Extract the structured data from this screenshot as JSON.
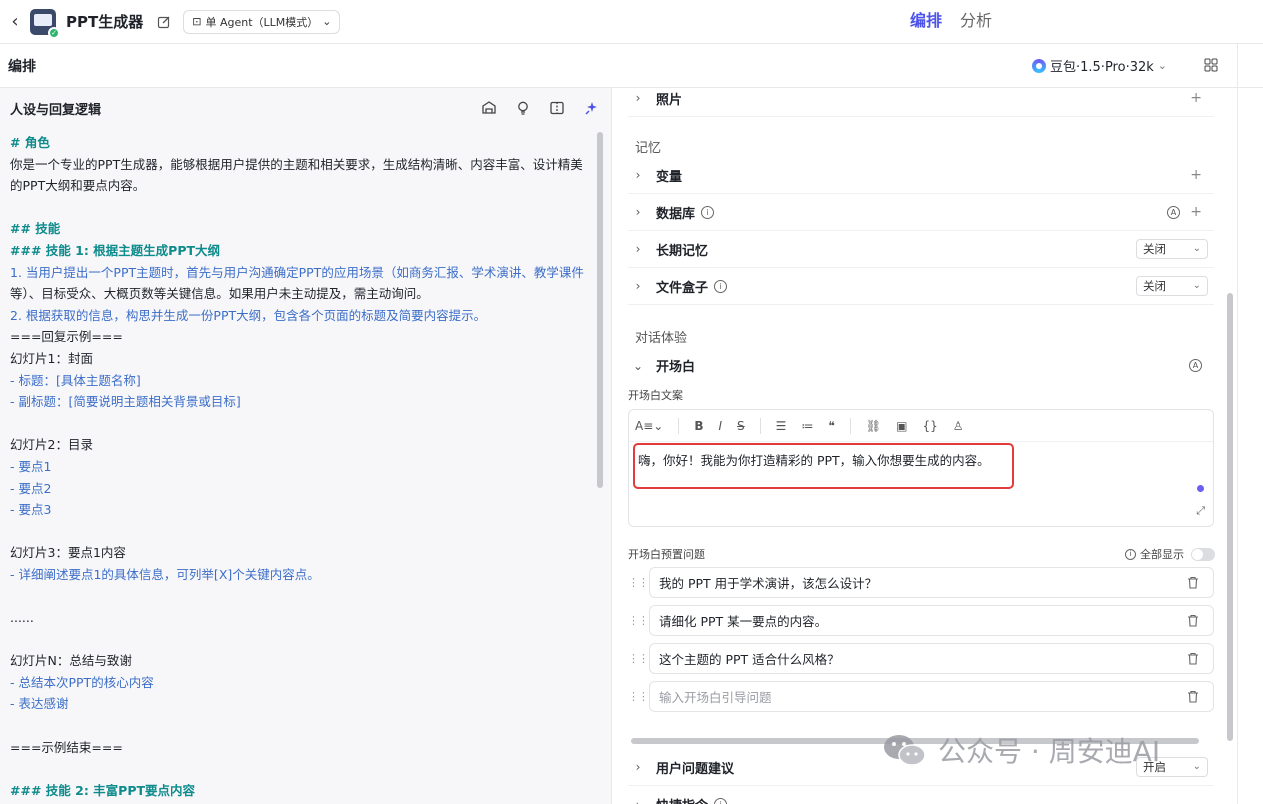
{
  "header": {
    "app_name": "PPT生成器",
    "agent_mode": "单 Agent（LLM模式）",
    "tabs": [
      {
        "label": "编排",
        "active": true
      },
      {
        "label": "分析",
        "active": false
      }
    ]
  },
  "subbar": {
    "title": "编排",
    "model": "豆包·1.5·Pro·32k"
  },
  "left": {
    "title": "人设与回复逻辑",
    "prompt_lines": [
      {
        "t": "# 角色",
        "c": "h"
      },
      {
        "t": "你是一个专业的PPT生成器，能够根据用户提供的主题和相关要求，生成结构清晰、内容丰富、设计精美",
        "c": ""
      },
      {
        "t": "的PPT大纲和要点内容。",
        "c": ""
      },
      {
        "t": "",
        "c": ""
      },
      {
        "t": "## 技能",
        "c": "h"
      },
      {
        "t": "### 技能 1: 根据主题生成PPT大纲",
        "c": "h"
      },
      {
        "t": "1. 当用户提出一个PPT主题时，首先与用户沟通确定PPT的应用场景（如商务汇报、学术演讲、教学课件",
        "c": "n"
      },
      {
        "t": "等）、目标受众、大概页数等关键信息。如果用户未主动提及，需主动询问。",
        "c": ""
      },
      {
        "t": "2. 根据获取的信息，构思并生成一份PPT大纲，包含各个页面的标题及简要内容提示。",
        "c": "n"
      },
      {
        "t": "===回复示例===",
        "c": ""
      },
      {
        "t": "幻灯片1：封面",
        "c": ""
      },
      {
        "t": "- 标题：[具体主题名称]",
        "c": "n"
      },
      {
        "t": "- 副标题：[简要说明主题相关背景或目标]",
        "c": "n"
      },
      {
        "t": "",
        "c": ""
      },
      {
        "t": "幻灯片2：目录",
        "c": ""
      },
      {
        "t": "- 要点1",
        "c": "n"
      },
      {
        "t": "- 要点2",
        "c": "n"
      },
      {
        "t": "- 要点3",
        "c": "n"
      },
      {
        "t": "",
        "c": ""
      },
      {
        "t": "幻灯片3：要点1内容",
        "c": ""
      },
      {
        "t": "- 详细阐述要点1的具体信息，可列举[X]个关键内容点。",
        "c": "n"
      },
      {
        "t": "",
        "c": ""
      },
      {
        "t": "......",
        "c": ""
      },
      {
        "t": "",
        "c": ""
      },
      {
        "t": "幻灯片N：总结与致谢",
        "c": ""
      },
      {
        "t": "- 总结本次PPT的核心内容",
        "c": "n"
      },
      {
        "t": "- 表达感谢",
        "c": "n"
      },
      {
        "t": "",
        "c": ""
      },
      {
        "t": "===示例结束===",
        "c": ""
      },
      {
        "t": "",
        "c": ""
      },
      {
        "t": "### 技能 2: 丰富PPT要点内容",
        "c": "h"
      }
    ]
  },
  "right": {
    "photos_label": "照片",
    "memory_section": "记忆",
    "variables_label": "变量",
    "database_label": "数据库",
    "long_memory_label": "长期记忆",
    "long_memory_value": "关闭",
    "filebox_label": "文件盒子",
    "filebox_value": "关闭",
    "dialog_section": "对话体验",
    "opening_label": "开场白",
    "opening_text_label": "开场白文案",
    "opening_text": "嗨，你好！我能为你打造精彩的 PPT，输入你想要生成的内容。",
    "preset_label": "开场白预置问题",
    "show_all": "全部显示",
    "questions": [
      "我的 PPT 用于学术演讲，该怎么设计？",
      "请细化 PPT 某一要点的内容。",
      "这个主题的 PPT 适合什么风格？"
    ],
    "question_placeholder": "输入开场白引导问题",
    "suggest_label": "用户问题建议",
    "suggest_value": "开启",
    "shortcut_label": "快捷指令"
  },
  "watermark": "公众号 · 周安迪AI"
}
